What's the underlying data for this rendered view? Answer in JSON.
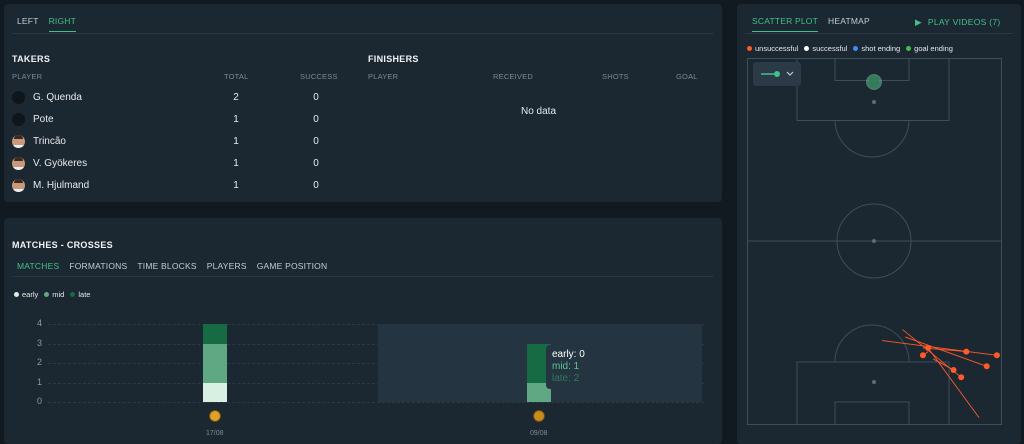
{
  "side_tabs": [
    {
      "label": "LEFT",
      "active": false
    },
    {
      "label": "RIGHT",
      "active": true
    }
  ],
  "takers": {
    "title": "TAKERS",
    "headers": {
      "player": "PLAYER",
      "total": "TOTAL",
      "success": "SUCCESS"
    },
    "rows": [
      {
        "name": "G. Quenda",
        "total": "2",
        "success": "0",
        "avatar": "blank"
      },
      {
        "name": "Pote",
        "total": "1",
        "success": "0",
        "avatar": "blank"
      },
      {
        "name": "Trincão",
        "total": "1",
        "success": "0",
        "avatar": "photo"
      },
      {
        "name": "V. Gyökeres",
        "total": "1",
        "success": "0",
        "avatar": "photo"
      },
      {
        "name": "M. Hjulmand",
        "total": "1",
        "success": "0",
        "avatar": "photo"
      }
    ]
  },
  "finishers": {
    "title": "FINISHERS",
    "headers": {
      "player": "PLAYER",
      "received": "RECEIVED",
      "shots": "SHOTS",
      "goal": "GOAL"
    },
    "empty_text": "No data"
  },
  "matches": {
    "title": "MATCHES - CROSSES",
    "tabs": [
      {
        "label": "MATCHES",
        "active": true
      },
      {
        "label": "FORMATIONS",
        "active": false
      },
      {
        "label": "TIME BLOCKS",
        "active": false
      },
      {
        "label": "PLAYERS",
        "active": false
      },
      {
        "label": "GAME POSITION",
        "active": false
      }
    ],
    "tooltip": {
      "early": "early: 0",
      "mid": "mid: 1",
      "late": "late: 2"
    }
  },
  "chart_data": {
    "type": "bar",
    "stacked": true,
    "categories": [
      "17/08",
      "09/08"
    ],
    "series": [
      {
        "name": "early",
        "values": [
          1,
          0
        ],
        "color": "#d8f0e2"
      },
      {
        "name": "mid",
        "values": [
          2,
          1
        ],
        "color": "#5fa883"
      },
      {
        "name": "late",
        "values": [
          1,
          2
        ],
        "color": "#166b45"
      }
    ],
    "yticks": [
      0,
      1,
      2,
      3,
      4
    ],
    "ylim": [
      0,
      4
    ],
    "grid": true,
    "legend": "top-left",
    "highlighted_category": "09/08"
  },
  "field": {
    "tabs": [
      {
        "label": "SCATTER PLOT",
        "active": true
      },
      {
        "label": "HEATMAP",
        "active": false
      }
    ],
    "play_label": "PLAY VIDEOS (7)",
    "legend": [
      {
        "label": "unsuccessful",
        "color": "#ff5a2a"
      },
      {
        "label": "successful",
        "color": "#ffffff"
      },
      {
        "label": "shot ending",
        "color": "#3d8bff"
      },
      {
        "label": "goal ending",
        "color": "#3fbf4b"
      }
    ],
    "crosses": [
      {
        "from": [
          0.53,
          0.77
        ],
        "to": [
          0.98,
          0.81
        ],
        "outcome": "unsuccessful"
      },
      {
        "from": [
          0.62,
          0.76
        ],
        "to": [
          0.94,
          0.84
        ],
        "outcome": "unsuccessful"
      },
      {
        "from": [
          0.61,
          0.74
        ],
        "to": [
          0.84,
          0.87
        ],
        "outcome": "unsuccessful"
      },
      {
        "from": [
          0.73,
          0.82
        ],
        "to": [
          0.81,
          0.85
        ],
        "outcome": "unsuccessful"
      },
      {
        "from": [
          0.69,
          0.79
        ],
        "to": [
          0.86,
          0.8
        ],
        "outcome": "unsuccessful"
      },
      {
        "from": [
          0.91,
          0.98
        ],
        "to": [
          0.71,
          0.79
        ],
        "outcome": "unsuccessful"
      },
      {
        "from": [
          0.71,
          0.8
        ],
        "to": [
          0.69,
          0.81
        ],
        "outcome": "unsuccessful"
      }
    ],
    "crosses_units": "fraction of pitch width (x) and pitch length (y)"
  },
  "icons": {
    "play": "play-icon",
    "chevron": "chevron-down-icon",
    "slider": "slider-icon"
  }
}
